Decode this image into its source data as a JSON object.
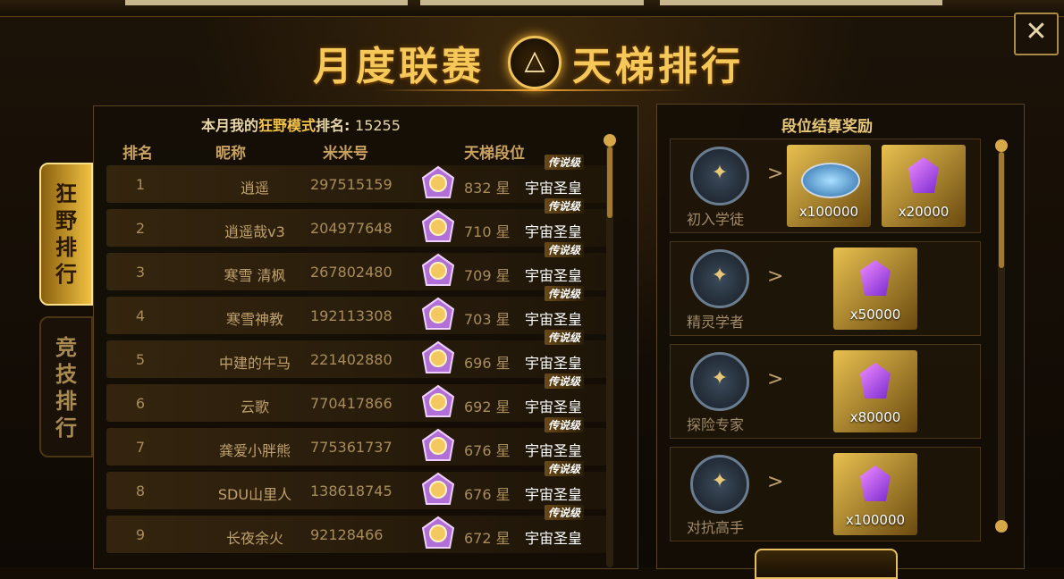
{
  "title": {
    "left": "月度联赛",
    "right": "天梯排行",
    "emblem_icon": "triangle-emblem-icon"
  },
  "close_label": "✕",
  "side_tabs": [
    {
      "label": "狂野排行",
      "active": true
    },
    {
      "label": "竞技排行",
      "active": false
    }
  ],
  "my_rank": {
    "prefix": "本月我的",
    "mode": "狂野模式",
    "suffix": "排名:",
    "value": "15255"
  },
  "columns": {
    "rank": "排名",
    "nickname": "昵称",
    "mimi_id": "米米号",
    "tier": "天梯段位"
  },
  "rows": [
    {
      "rank": "1",
      "nick": "逍遥",
      "mid": "297515159",
      "stars": "832",
      "star_label": "星",
      "tier": "宇宙圣皇",
      "tag": "传说级"
    },
    {
      "rank": "2",
      "nick": "逍遥哉v3",
      "mid": "204977648",
      "stars": "710",
      "star_label": "星",
      "tier": "宇宙圣皇",
      "tag": "传说级"
    },
    {
      "rank": "3",
      "nick": "寒雪 清枫",
      "mid": "267802480",
      "stars": "709",
      "star_label": "星",
      "tier": "宇宙圣皇",
      "tag": "传说级"
    },
    {
      "rank": "4",
      "nick": "寒雪神教",
      "mid": "192113308",
      "stars": "703",
      "star_label": "星",
      "tier": "宇宙圣皇",
      "tag": "传说级"
    },
    {
      "rank": "5",
      "nick": "中建的牛马",
      "mid": "221402880",
      "stars": "696",
      "star_label": "星",
      "tier": "宇宙圣皇",
      "tag": "传说级"
    },
    {
      "rank": "6",
      "nick": "云歌",
      "mid": "770417866",
      "stars": "692",
      "star_label": "星",
      "tier": "宇宙圣皇",
      "tag": "传说级"
    },
    {
      "rank": "7",
      "nick": "龚爱小胖熊",
      "mid": "775361737",
      "stars": "676",
      "star_label": "星",
      "tier": "宇宙圣皇",
      "tag": "传说级"
    },
    {
      "rank": "8",
      "nick": "SDU山里人",
      "mid": "138618745",
      "stars": "676",
      "star_label": "星",
      "tier": "宇宙圣皇",
      "tag": "传说级"
    },
    {
      "rank": "9",
      "nick": "长夜余火",
      "mid": "92128466",
      "stars": "672",
      "star_label": "星",
      "tier": "宇宙圣皇",
      "tag": "传说级"
    }
  ],
  "rewards_title": "段位结算奖励",
  "rewards": [
    {
      "rank_name": "初入学徒",
      "items": [
        {
          "icon": "disc-item-icon",
          "amount": "x100000"
        },
        {
          "icon": "crystal-icon",
          "amount": "x20000"
        }
      ]
    },
    {
      "rank_name": "精灵学者",
      "items": [
        {
          "icon": "crystal-icon",
          "amount": "x50000"
        }
      ]
    },
    {
      "rank_name": "探险专家",
      "items": [
        {
          "icon": "crystal-icon",
          "amount": "x80000"
        }
      ]
    },
    {
      "rank_name": "对抗高手",
      "items": [
        {
          "icon": "crystal-icon",
          "amount": "x100000"
        }
      ]
    }
  ],
  "arrow": ">"
}
